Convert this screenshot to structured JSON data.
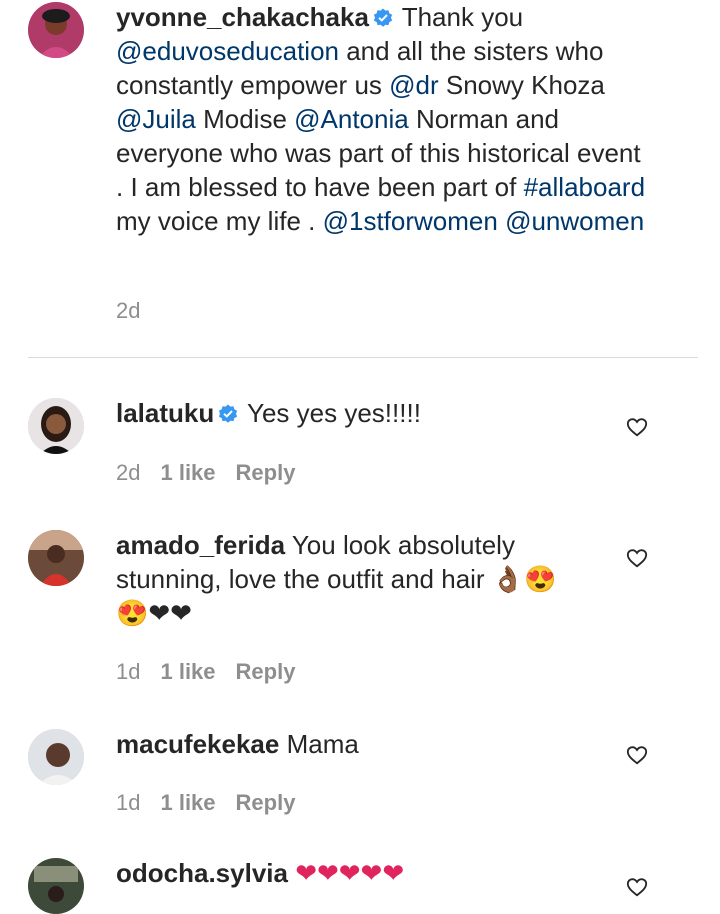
{
  "caption": {
    "username": "yvonne_chakachaka",
    "segments": [
      {
        "t": "Thank you ",
        "m": false
      },
      {
        "t": "@eduvoseducation",
        "m": true
      },
      {
        "t": " and all the sisters who constantly empower us ",
        "m": false
      },
      {
        "t": "@dr",
        "m": true
      },
      {
        "t": " Snowy Khoza ",
        "m": false
      },
      {
        "t": "@Juila",
        "m": true
      },
      {
        "t": " Modise ",
        "m": false
      },
      {
        "t": "@Antonia",
        "m": true
      },
      {
        "t": " Norman and everyone who was part of this historical event . I am blessed to have been part of ",
        "m": false
      },
      {
        "t": "#allaboard",
        "m": true
      },
      {
        "t": " my voice my life . ",
        "m": false
      },
      {
        "t": "@1stforwomen",
        "m": true
      },
      {
        "t": " ",
        "m": false
      },
      {
        "t": "@unwomen",
        "m": true
      }
    ],
    "time": "2d"
  },
  "comments": [
    {
      "username": "lalatuku",
      "verified": true,
      "text": "Yes yes yes!!!!!",
      "time": "2d",
      "likes": "1 like",
      "reply": "Reply"
    },
    {
      "username": "amado_ferida",
      "verified": false,
      "text": "You look absolutely stunning, love the outfit and hair 👌🏾😍😍❤❤",
      "time": "1d",
      "likes": "1 like",
      "reply": "Reply"
    },
    {
      "username": "macufekekae",
      "verified": false,
      "text": "Mama",
      "time": "1d",
      "likes": "1 like",
      "reply": "Reply"
    },
    {
      "username": "odocha.sylvia",
      "verified": false,
      "text": "❤❤❤❤❤",
      "time": "",
      "likes": "",
      "reply": ""
    }
  ],
  "colors": {
    "mention": "#00376b",
    "meta": "#8e8e8e",
    "verified": "#3897f0",
    "heart_emoji": "#e0245e"
  }
}
